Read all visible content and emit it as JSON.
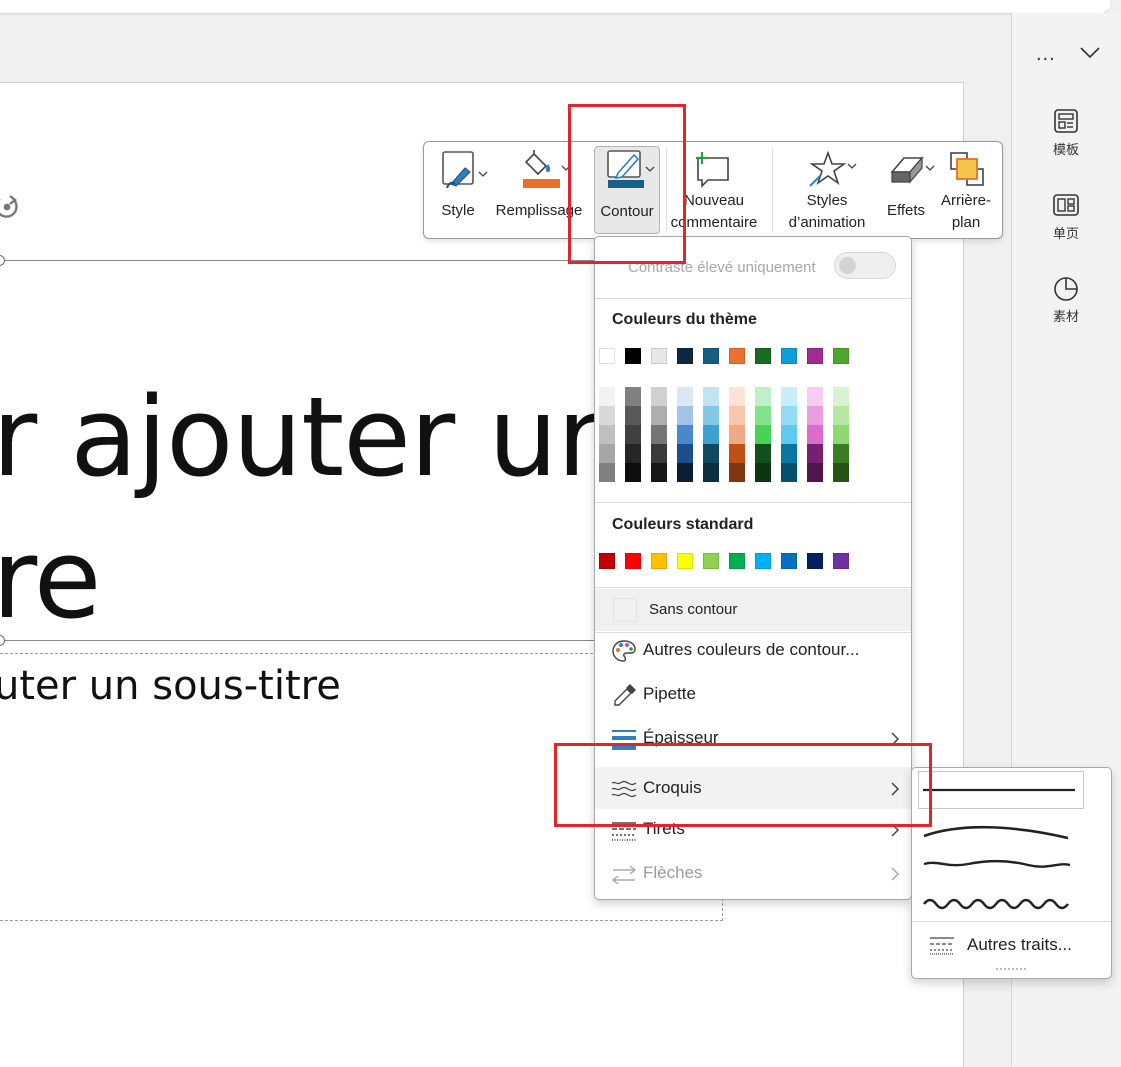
{
  "toolbar": {
    "style": "Style",
    "fill": "Remplissage",
    "outline": "Contour",
    "comment_line1": "Nouveau",
    "comment_line2": "commentaire",
    "anim_line1": "Styles",
    "anim_line2": "d’animation",
    "effects": "Effets",
    "bg_line1": "Arrière-",
    "bg_line2": "plan"
  },
  "sidepane": {
    "more": "...",
    "templates": "模板",
    "single_page": "单页",
    "assets": "素材"
  },
  "slide": {
    "title_line1": "r ajouter un",
    "title_line2": "re",
    "subtitle": "uter un sous-titre"
  },
  "dropdown": {
    "high_contrast": "Contraste élevé uniquement",
    "theme_colors_heading": "Couleurs du thème",
    "standard_colors_heading": "Couleurs standard",
    "no_outline": "Sans contour",
    "more_colors": "Autres couleurs de contour...",
    "eyedropper": "Pipette",
    "weight": "Épaisseur",
    "sketch": "Croquis",
    "dashes": "Tirets",
    "arrows": "Flèches"
  },
  "submenu": {
    "more_lines": "Autres traits..."
  },
  "colors": {
    "accent_fill": "#e8702a",
    "accent_outline": "#1a5e8a",
    "highlight_red": "#e0252b",
    "theme_row": [
      "#ffffff",
      "#000000",
      "#e8e8e8",
      "#0e2841",
      "#156082",
      "#e97132",
      "#196b24",
      "#0f9ed5",
      "#a02b93",
      "#4ea72e"
    ],
    "theme_shades": [
      [
        "#f2f2f2",
        "#d9d9d9",
        "#bfbfbf",
        "#a6a6a6",
        "#808080"
      ],
      [
        "#808080",
        "#595959",
        "#404040",
        "#262626",
        "#0d0d0d"
      ],
      [
        "#d0d0d0",
        "#aeaeae",
        "#757575",
        "#3a3a3a",
        "#171717"
      ],
      [
        "#dbe7f5",
        "#a3c3e8",
        "#4a87d0",
        "#1d4e89",
        "#0b1e36"
      ],
      [
        "#c3e3f2",
        "#86c7e5",
        "#3aa1d0",
        "#104862",
        "#0a2f41"
      ],
      [
        "#fbe3d6",
        "#f6c6ad",
        "#f1a983",
        "#c04f15",
        "#80350e"
      ],
      [
        "#c1f0c8",
        "#83e28e",
        "#46d356",
        "#124f1a",
        "#0c3512"
      ],
      [
        "#caeef9",
        "#94dcf4",
        "#5fcaee",
        "#0b76a0",
        "#074f6a"
      ],
      [
        "#f4cdef",
        "#e89fe0",
        "#dc6dcf",
        "#782070",
        "#50154b"
      ],
      [
        "#dbf2d0",
        "#b5e6a2",
        "#8fd973",
        "#3a7d22",
        "#275317"
      ]
    ],
    "standard_row": [
      "#c00000",
      "#ff0000",
      "#ffc000",
      "#ffff00",
      "#92d050",
      "#00b050",
      "#00b0f0",
      "#0070c0",
      "#002060",
      "#7030a0"
    ]
  }
}
